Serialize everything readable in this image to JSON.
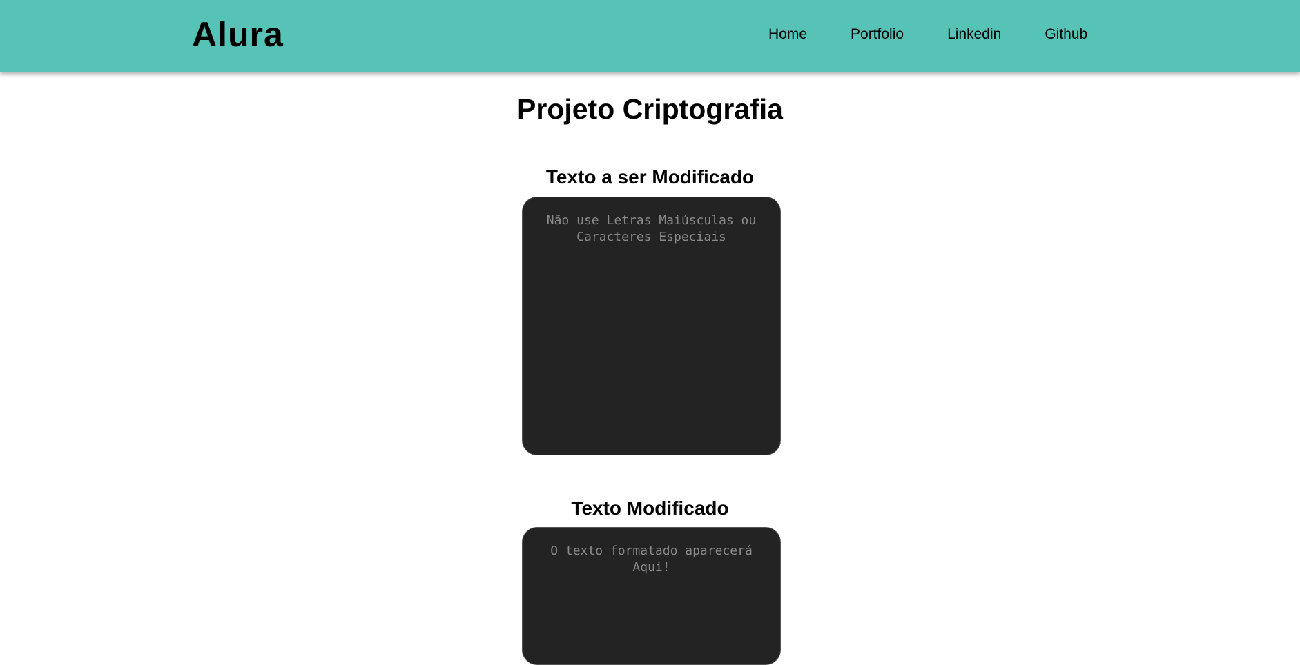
{
  "header": {
    "logo": "Alura",
    "nav": [
      "Home",
      "Portfolio",
      "Linkedin",
      "Github"
    ]
  },
  "main": {
    "title": "Projeto Criptografia",
    "input_section": {
      "heading": "Texto a ser Modificado",
      "placeholder": "Não use Letras Maiúsculas ou Caracteres Especiais",
      "value": ""
    },
    "output_section": {
      "heading": "Texto Modificado",
      "placeholder": "O texto formatado aparecerá Aqui!",
      "value": ""
    }
  },
  "colors": {
    "header_bg": "#56c3b6",
    "textbox_bg": "#232323",
    "placeholder": "#8a8a8a"
  }
}
